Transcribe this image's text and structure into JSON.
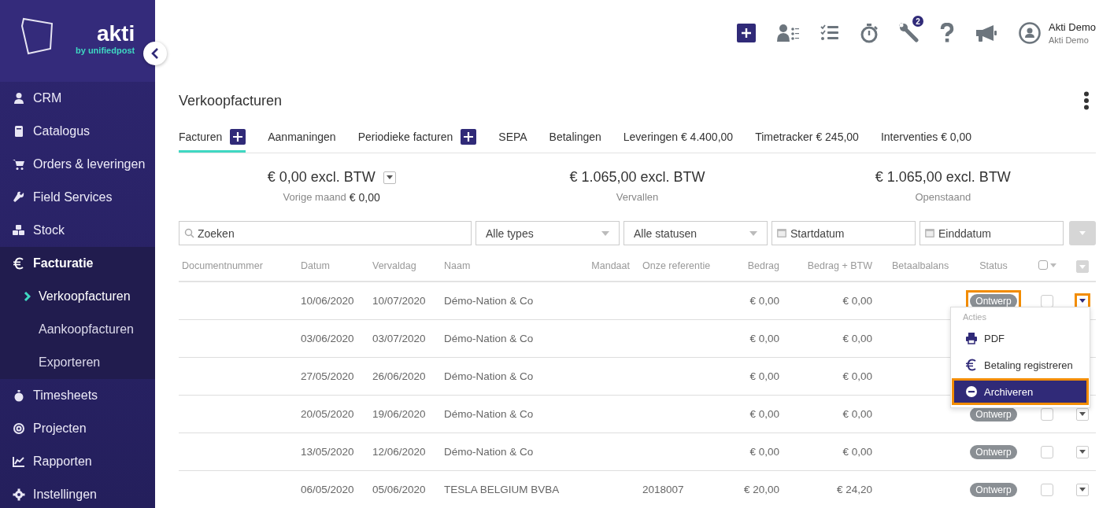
{
  "logo": {
    "name": "akti",
    "tagline": "by unifiedpost"
  },
  "sidebar": {
    "items": [
      {
        "label": "CRM",
        "expanded": false
      },
      {
        "label": "Catalogus",
        "expanded": false
      },
      {
        "label": "Orders & leveringen",
        "expanded": false
      },
      {
        "label": "Field Services",
        "expanded": false
      },
      {
        "label": "Stock",
        "expanded": false
      },
      {
        "label": "Facturatie",
        "expanded": true,
        "children": [
          {
            "label": "Verkoopfacturen",
            "selected": true
          },
          {
            "label": "Aankoopfacturen",
            "selected": false
          },
          {
            "label": "Exporteren",
            "selected": false
          }
        ]
      },
      {
        "label": "Timesheets",
        "expanded": false
      },
      {
        "label": "Projecten",
        "expanded": false
      },
      {
        "label": "Rapporten",
        "expanded": false
      },
      {
        "label": "Instellingen",
        "expanded": false
      }
    ]
  },
  "topbar": {
    "notification_count": "2",
    "user": {
      "name": "Akti Demo",
      "company": "Akti Demo"
    }
  },
  "page": {
    "title": "Verkoopfacturen"
  },
  "tabs": [
    {
      "label": "Facturen",
      "selected": true,
      "has_add": true
    },
    {
      "label": "Aanmaningen",
      "selected": false,
      "has_add": false
    },
    {
      "label": "Periodieke facturen",
      "selected": false,
      "has_add": true
    },
    {
      "label": "SEPA",
      "selected": false,
      "has_add": false
    },
    {
      "label": "Betalingen",
      "selected": false,
      "has_add": false
    },
    {
      "label": "Leveringen € 4.400,00",
      "selected": false,
      "has_add": false
    },
    {
      "label": "Timetracker € 245,00",
      "selected": false,
      "has_add": false
    },
    {
      "label": "Interventies € 0,00",
      "selected": false,
      "has_add": false
    }
  ],
  "summary": [
    {
      "amount": "€ 0,00 excl. BTW",
      "label": "Vorige maand",
      "label_value": "€ 0,00",
      "has_dropdown": true
    },
    {
      "amount": "€ 1.065,00 excl. BTW",
      "label": "Vervallen",
      "has_dropdown": false
    },
    {
      "amount": "€ 1.065,00 excl. BTW",
      "label": "Openstaand",
      "has_dropdown": false
    }
  ],
  "filters": {
    "search": {
      "placeholder": "Zoeken"
    },
    "type_select": "Alle types",
    "status_select": "Alle statusen",
    "start_date": {
      "placeholder": "Startdatum"
    },
    "end_date": {
      "placeholder": "Einddatum"
    }
  },
  "table": {
    "columns": [
      "Documentnummer",
      "Datum",
      "Vervaldag",
      "Naam",
      "Mandaat",
      "Onze referentie",
      "Bedrag",
      "Bedrag + BTW",
      "Betaalbalans",
      "Status"
    ],
    "select_all_checked": false,
    "rows": [
      {
        "datum": "10/06/2020",
        "vervaldag": "10/07/2020",
        "naam": "Démo-Nation & Co",
        "bedrag": "€ 0,00",
        "bedrag_btw": "€ 0,00",
        "status": "Ontwerp",
        "checked": false,
        "highlighted": true
      },
      {
        "datum": "03/06/2020",
        "vervaldag": "03/07/2020",
        "naam": "Démo-Nation & Co",
        "bedrag": "€ 0,00",
        "bedrag_btw": "€ 0,00"
      },
      {
        "datum": "27/05/2020",
        "vervaldag": "26/06/2020",
        "naam": "Démo-Nation & Co",
        "bedrag": "€ 0,00",
        "bedrag_btw": "€ 0,00"
      },
      {
        "datum": "20/05/2020",
        "vervaldag": "19/06/2020",
        "naam": "Démo-Nation & Co",
        "bedrag": "€ 0,00",
        "bedrag_btw": "€ 0,00",
        "status": "Ontwerp",
        "checked": false,
        "highlighted": false
      },
      {
        "datum": "13/05/2020",
        "vervaldag": "12/06/2020",
        "naam": "Démo-Nation & Co",
        "bedrag": "€ 0,00",
        "bedrag_btw": "€ 0,00",
        "status": "Ontwerp",
        "checked": false,
        "highlighted": false
      },
      {
        "datum": "06/05/2020",
        "vervaldag": "05/06/2020",
        "naam": "TESLA BELGIUM BVBA",
        "referentie": "2018007",
        "bedrag": "€ 20,00",
        "bedrag_btw": "€ 24,20",
        "status": "Ontwerp",
        "checked": false,
        "highlighted": false
      }
    ]
  },
  "action_menu": {
    "header": "Acties",
    "items": [
      {
        "label": "PDF",
        "highlighted": false
      },
      {
        "label": "Betaling registreren",
        "highlighted": false
      },
      {
        "label": "Archiveren",
        "highlighted": true
      }
    ]
  }
}
